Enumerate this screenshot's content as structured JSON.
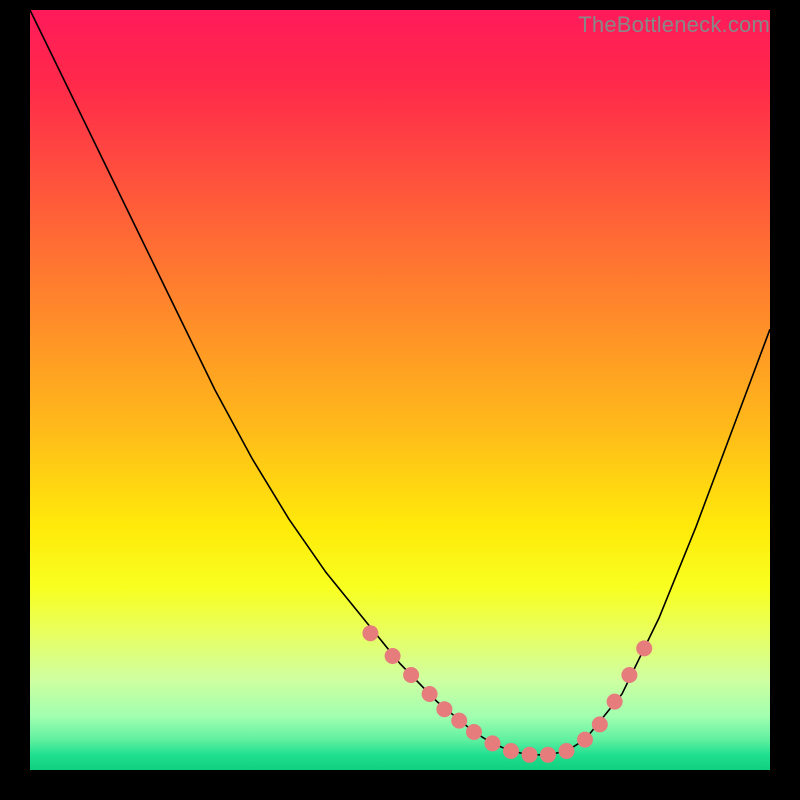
{
  "watermark": "TheBottleneck.com",
  "chart_data": {
    "type": "line",
    "title": "",
    "xlabel": "",
    "ylabel": "",
    "xlim": [
      0,
      100
    ],
    "ylim": [
      0,
      100
    ],
    "x": [
      0,
      5,
      10,
      15,
      20,
      25,
      30,
      35,
      40,
      45,
      50,
      55,
      60,
      62.5,
      65,
      67.5,
      70,
      72.5,
      75,
      80,
      85,
      90,
      95,
      100
    ],
    "values": [
      100,
      90,
      80,
      70,
      60,
      50,
      41,
      33,
      26,
      20,
      14,
      9,
      5,
      3.5,
      2.5,
      2,
      2,
      2.5,
      4,
      10,
      20,
      32,
      45,
      58
    ],
    "highlight_markers": {
      "x": [
        46,
        49,
        51.5,
        54,
        56,
        58,
        60,
        62.5,
        65,
        67.5,
        70,
        72.5,
        75,
        77,
        79,
        81,
        83
      ],
      "y": [
        18,
        15,
        12.5,
        10,
        8,
        6.5,
        5,
        3.5,
        2.5,
        2,
        2,
        2.5,
        4,
        6,
        9,
        12.5,
        16
      ]
    }
  }
}
